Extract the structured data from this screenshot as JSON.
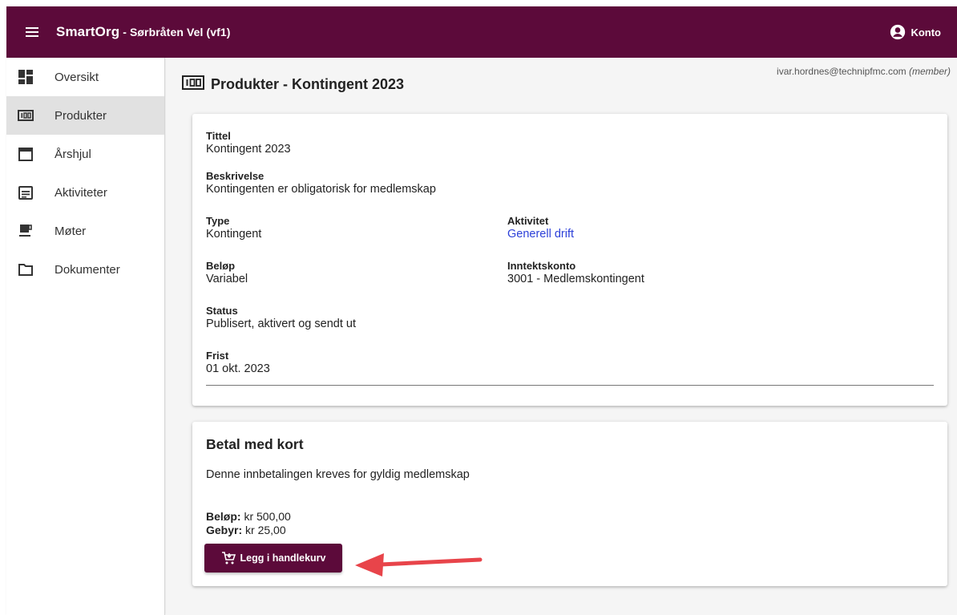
{
  "colors": {
    "brand": "#5c0a3a",
    "link": "#2b3fd8",
    "arrow": "#e8444a"
  },
  "header": {
    "app_name": "SmartOrg",
    "org_name": " - Sørbråten Vel (vf1)",
    "account_label": "Konto",
    "icons": {
      "menu": "hamburger-icon",
      "account": "account-circle-icon"
    }
  },
  "sidebar": {
    "items": [
      {
        "label": "Oversikt",
        "icon": "dashboard-icon"
      },
      {
        "label": "Produkter",
        "icon": "counter-icon",
        "active": true
      },
      {
        "label": "Årshjul",
        "icon": "calendar-icon"
      },
      {
        "label": "Aktiviteter",
        "icon": "activity-list-icon"
      },
      {
        "label": "Møter",
        "icon": "coffee-icon"
      },
      {
        "label": "Dokumenter",
        "icon": "folder-icon"
      }
    ]
  },
  "user": {
    "email": "ivar.hordnes@technipfmc.com",
    "role": "(member)"
  },
  "page": {
    "title": "Produkter - Kontingent 2023"
  },
  "product": {
    "tittel": {
      "label": "Tittel",
      "value": "Kontingent 2023"
    },
    "beskrivelse": {
      "label": "Beskrivelse",
      "value": "Kontingenten er obligatorisk for medlemskap"
    },
    "type": {
      "label": "Type",
      "value": "Kontingent"
    },
    "aktivitet": {
      "label": "Aktivitet",
      "value": "Generell drift"
    },
    "belop": {
      "label": "Beløp",
      "value": "Variabel"
    },
    "inntektskonto": {
      "label": "Inntektskonto",
      "value": "3001 - Medlemskontingent"
    },
    "status": {
      "label": "Status",
      "value": "Publisert, aktivert og sendt ut"
    },
    "frist": {
      "label": "Frist",
      "value": "01 okt. 2023"
    }
  },
  "payment": {
    "title": "Betal med kort",
    "description": "Denne innbetalingen kreves for gyldig medlemskap",
    "amount_label": "Beløp:",
    "amount_value": "kr 500,00",
    "fee_label": "Gebyr:",
    "fee_value": "kr 25,00",
    "button_label": "Legg i handlekurv",
    "button_icon": "cart-icon"
  }
}
